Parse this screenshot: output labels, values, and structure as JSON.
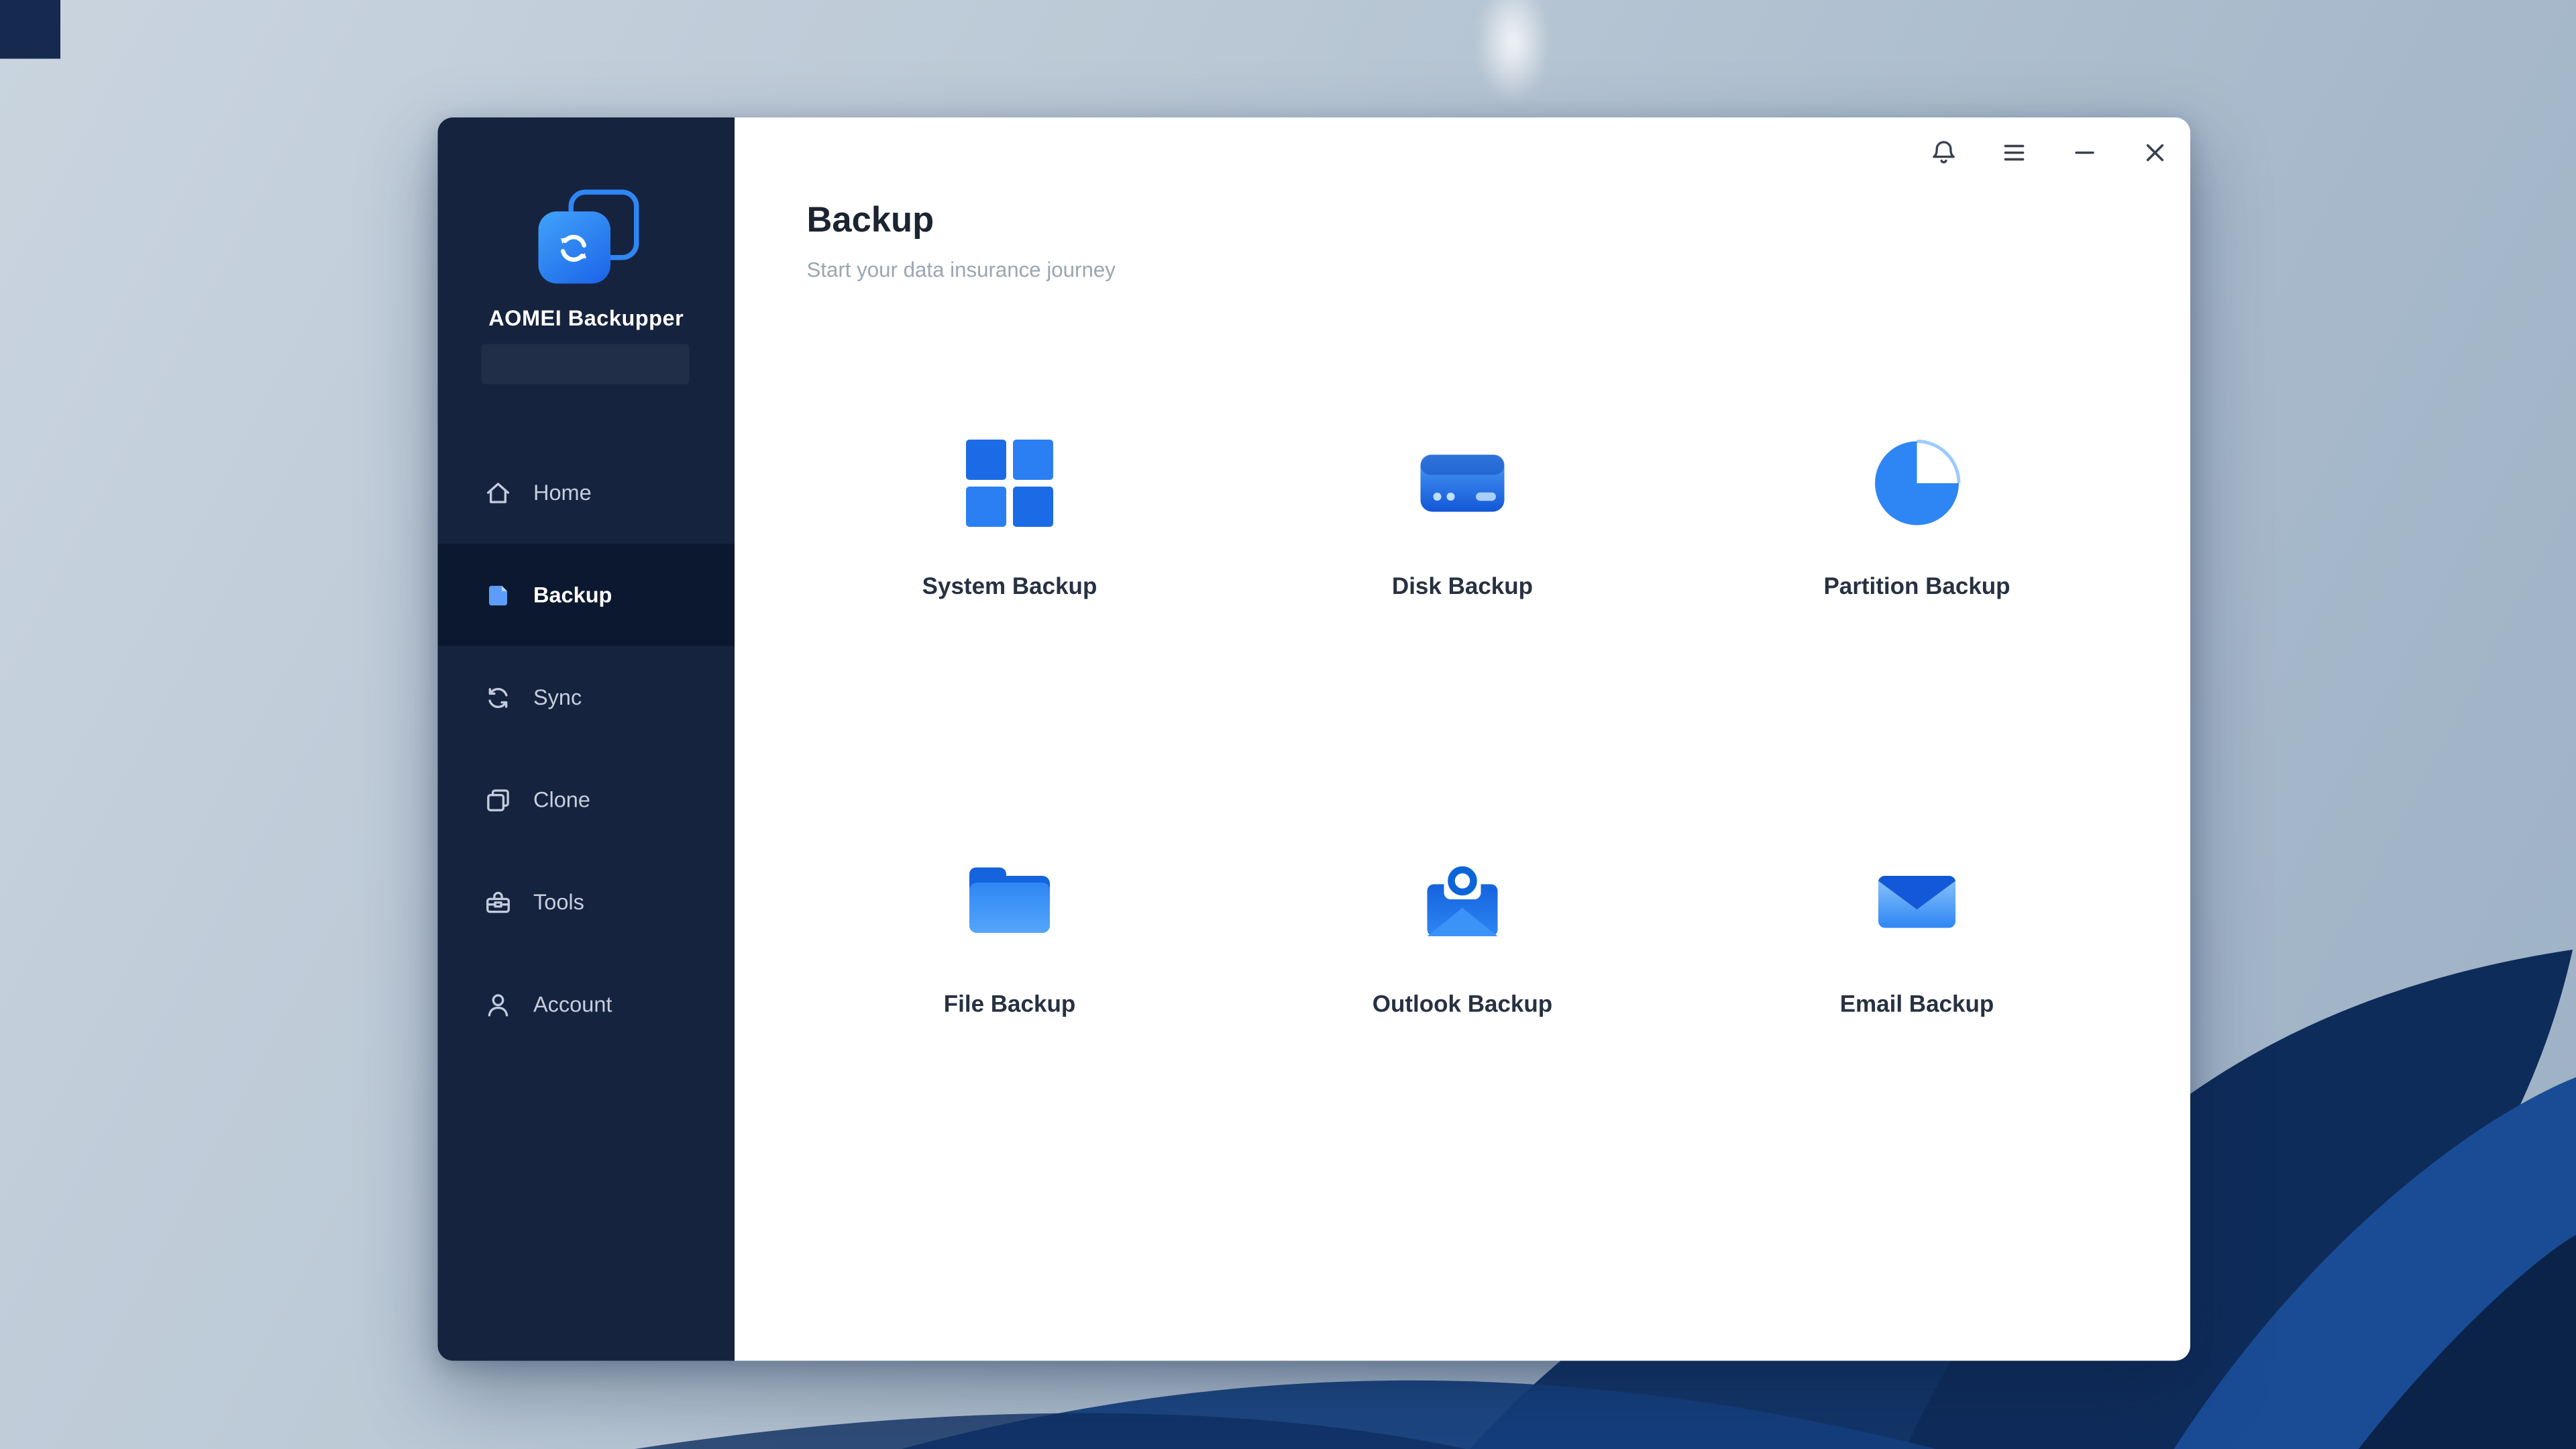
{
  "sidebar": {
    "brand": "AOMEI Backupper",
    "items": [
      {
        "label": "Home",
        "icon": "home-icon",
        "active": false
      },
      {
        "label": "Backup",
        "icon": "backup-icon",
        "active": true
      },
      {
        "label": "Sync",
        "icon": "sync-icon",
        "active": false
      },
      {
        "label": "Clone",
        "icon": "clone-icon",
        "active": false
      },
      {
        "label": "Tools",
        "icon": "tools-icon",
        "active": false
      },
      {
        "label": "Account",
        "icon": "account-icon",
        "active": false
      }
    ]
  },
  "header": {
    "title": "Backup",
    "subtitle": "Start your data insurance journey"
  },
  "tiles": [
    {
      "label": "System Backup",
      "icon": "system-backup-icon"
    },
    {
      "label": "Disk Backup",
      "icon": "disk-backup-icon"
    },
    {
      "label": "Partition Backup",
      "icon": "partition-backup-icon"
    },
    {
      "label": "File Backup",
      "icon": "file-backup-icon"
    },
    {
      "label": "Outlook Backup",
      "icon": "outlook-backup-icon"
    },
    {
      "label": "Email Backup",
      "icon": "email-backup-icon"
    }
  ],
  "window_controls": [
    {
      "name": "notifications",
      "icon": "bell-icon"
    },
    {
      "name": "menu",
      "icon": "hamburger-icon"
    },
    {
      "name": "minimize",
      "icon": "minimize-icon"
    },
    {
      "name": "close",
      "icon": "close-icon"
    }
  ],
  "colors": {
    "accent_blue": "#2B7FF2",
    "sidebar_bg": "#16233E",
    "sidebar_active_bg": "#0C1830",
    "window_bg": "#FFFFFF",
    "desktop_light": "#C9D4DF",
    "desktop_dark": "#9DB1C5",
    "bloom_navy": "#123568"
  }
}
